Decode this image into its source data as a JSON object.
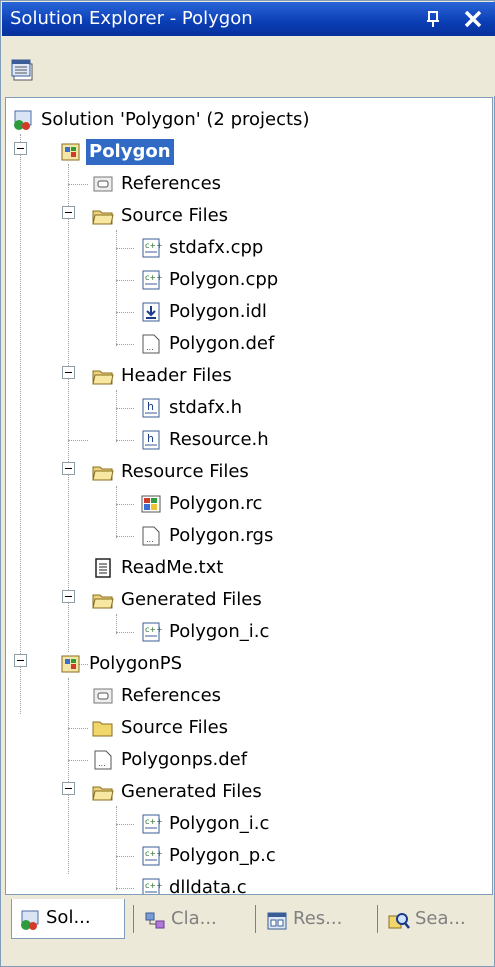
{
  "window": {
    "title": "Solution Explorer - Polygon",
    "pin_glyph": "↑",
    "close_glyph": "✕"
  },
  "toolbar": {
    "properties_icon": "properties-icon"
  },
  "tree": {
    "solution": "Solution 'Polygon' (2 projects)",
    "project1": {
      "name": "Polygon",
      "references": "References",
      "source_files": {
        "label": "Source Files",
        "items": [
          "stdafx.cpp",
          "Polygon.cpp",
          "Polygon.idl",
          "Polygon.def"
        ]
      },
      "header_files": {
        "label": "Header Files",
        "items": [
          "stdafx.h",
          "Resource.h"
        ]
      },
      "resource_files": {
        "label": "Resource Files",
        "items": [
          "Polygon.rc",
          "Polygon.rgs"
        ]
      },
      "readme": "ReadMe.txt",
      "generated_files": {
        "label": "Generated Files",
        "items": [
          "Polygon_i.c"
        ]
      }
    },
    "project2": {
      "name": "PolygonPS",
      "references": "References",
      "source_files": "Source Files",
      "def_file": "Polygonps.def",
      "generated_files": {
        "label": "Generated Files",
        "items": [
          "Polygon_i.c",
          "Polygon_p.c",
          "dlldata.c"
        ]
      }
    }
  },
  "tabs": [
    {
      "label": "Sol...",
      "icon": "solution-explorer-icon",
      "active": true
    },
    {
      "label": "Cla...",
      "icon": "class-view-icon",
      "active": false
    },
    {
      "label": "Res...",
      "icon": "resource-view-icon",
      "active": false
    },
    {
      "label": "Sea...",
      "icon": "search-icon",
      "active": false
    }
  ],
  "colors": {
    "title_bar": "#0a3db4",
    "selection": "#316ac5",
    "background": "#ece9d8"
  }
}
